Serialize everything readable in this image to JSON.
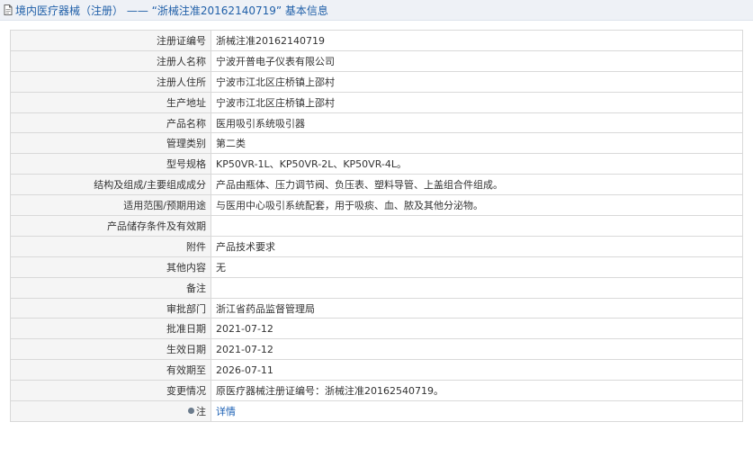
{
  "header": {
    "category": "境内医疗器械（注册）",
    "separator": "——",
    "reg_title": "“浙械注准20162140719”",
    "suffix": "基本信息"
  },
  "rows": [
    {
      "label": "注册证编号",
      "value": "浙械注准20162140719"
    },
    {
      "label": "注册人名称",
      "value": "宁波开普电子仪表有限公司"
    },
    {
      "label": "注册人住所",
      "value": "宁波市江北区庄桥镇上邵村"
    },
    {
      "label": "生产地址",
      "value": "宁波市江北区庄桥镇上邵村"
    },
    {
      "label": "产品名称",
      "value": "医用吸引系统吸引器"
    },
    {
      "label": "管理类别",
      "value": "第二类"
    },
    {
      "label": "型号规格",
      "value": "KP50VR-1L、KP50VR-2L、KP50VR-4L。"
    },
    {
      "label": "结构及组成/主要组成成分",
      "value": "产品由瓶体、压力调节阀、负压表、塑料导管、上盖组合件组成。"
    },
    {
      "label": "适用范围/预期用途",
      "value": "与医用中心吸引系统配套，用于吸痰、血、脓及其他分泌物。"
    },
    {
      "label": "产品储存条件及有效期",
      "value": ""
    },
    {
      "label": "附件",
      "value": "产品技术要求"
    },
    {
      "label": "其他内容",
      "value": "无"
    },
    {
      "label": "备注",
      "value": ""
    },
    {
      "label": "审批部门",
      "value": "浙江省药品监督管理局"
    },
    {
      "label": "批准日期",
      "value": "2021-07-12"
    },
    {
      "label": "生效日期",
      "value": "2021-07-12"
    },
    {
      "label": "有效期至",
      "value": "2026-07-11"
    },
    {
      "label": "变更情况",
      "value": "原医疗器械注册证编号：浙械注准20162540719。"
    },
    {
      "label": "注",
      "value": "详情"
    }
  ]
}
